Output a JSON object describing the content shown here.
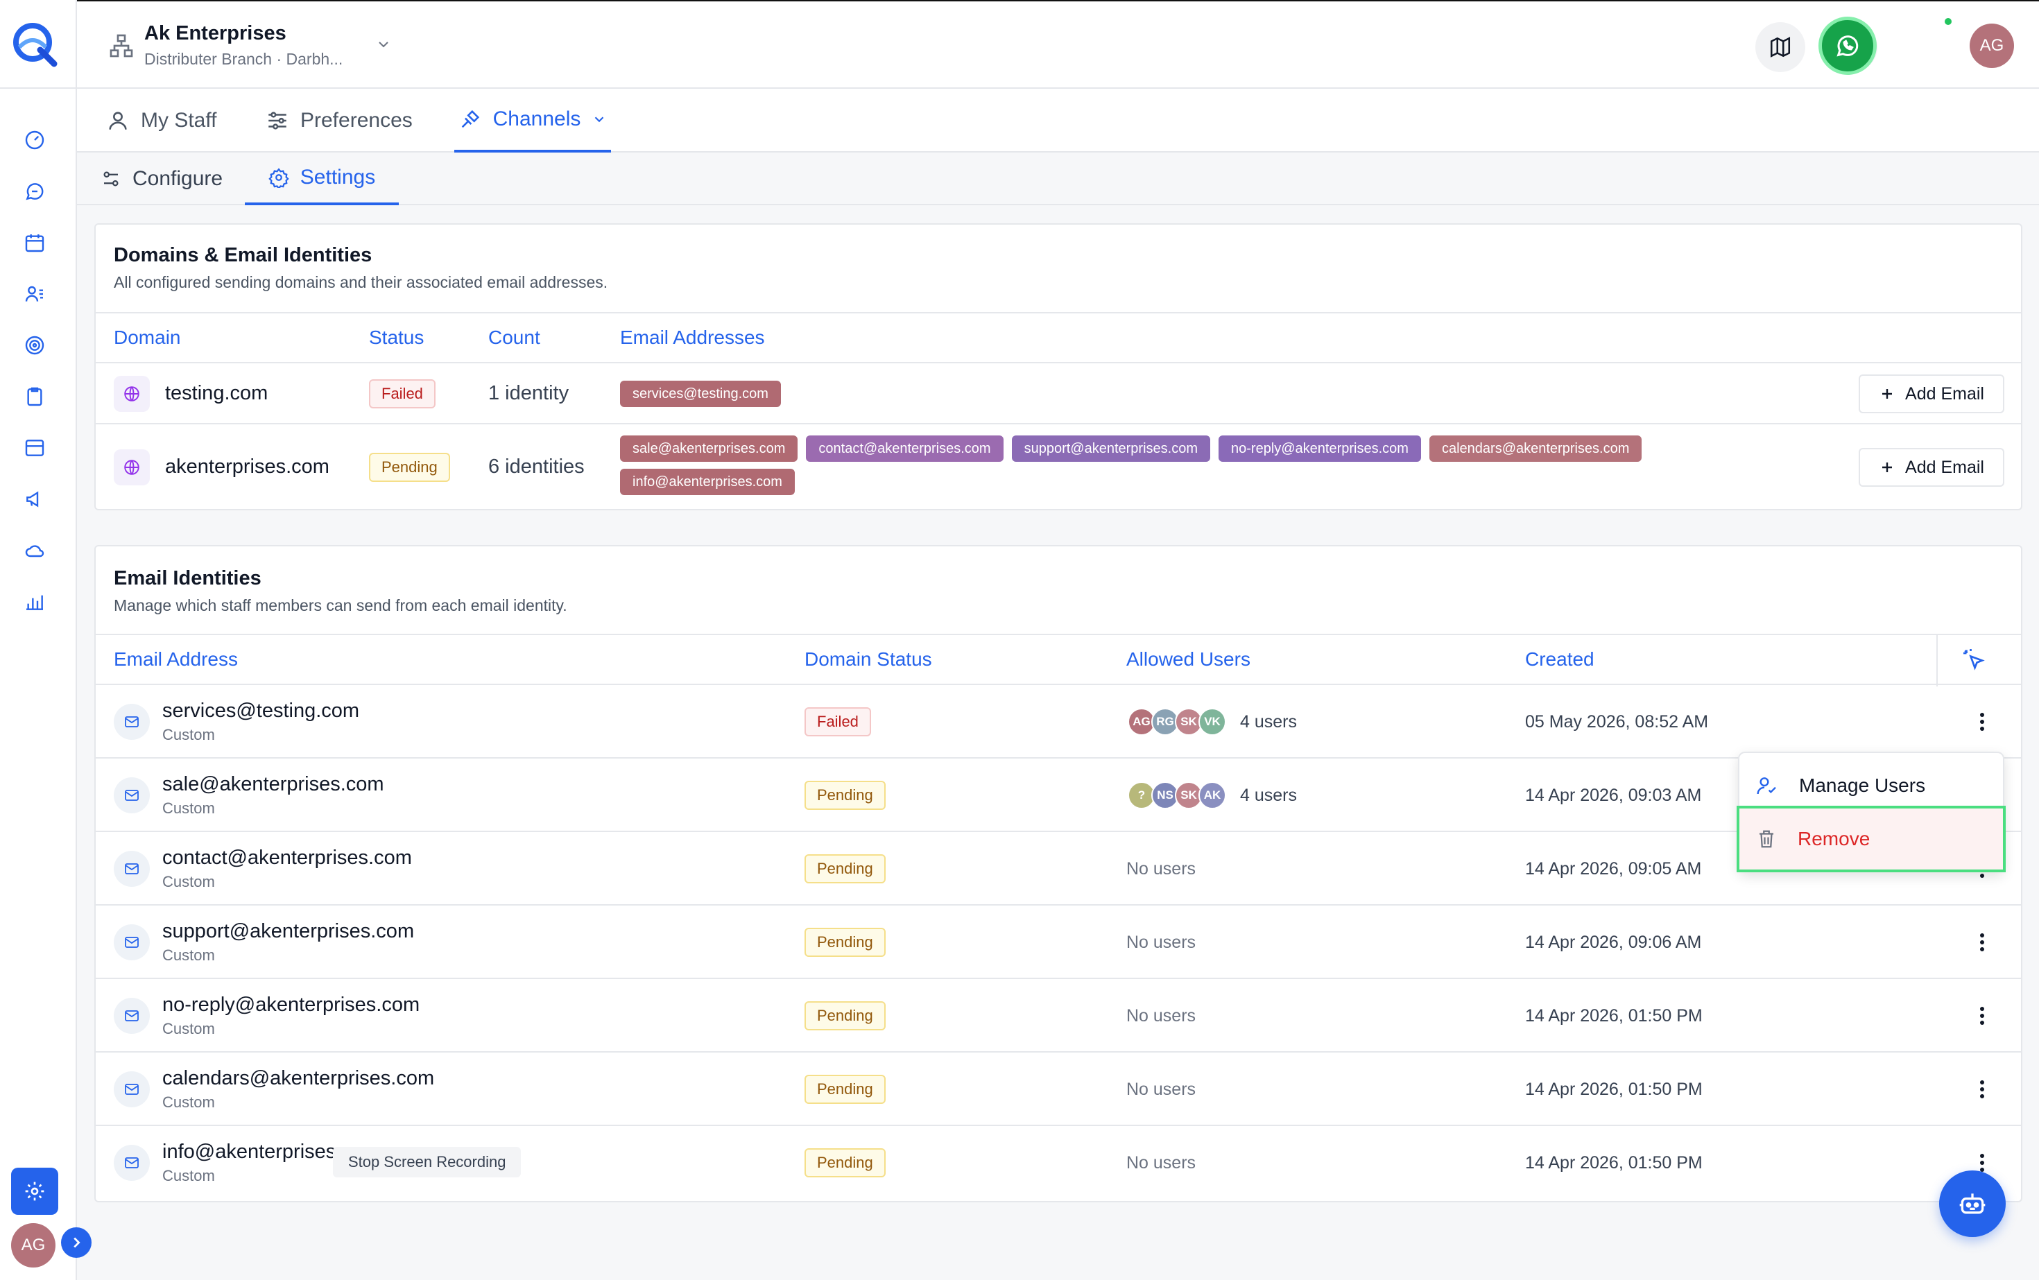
{
  "header": {
    "org_name": "Ak Enterprises",
    "org_sub": "Distributer Branch · Darbh...",
    "avatar": "AG"
  },
  "sidebar": {
    "icons": [
      "dashboard-icon",
      "chat-icon",
      "calendar-icon",
      "contacts-icon",
      "target-icon",
      "clipboard-icon",
      "inbox-icon",
      "megaphone-icon",
      "cloud-icon",
      "bar-chart-icon"
    ],
    "avatar": "AG"
  },
  "tabs": [
    {
      "label": "My Staff"
    },
    {
      "label": "Preferences"
    },
    {
      "label": "Channels"
    }
  ],
  "subtabs": [
    {
      "label": "Configure"
    },
    {
      "label": "Settings"
    }
  ],
  "domains_card": {
    "title": "Domains & Email Identities",
    "description": "All configured sending domains and their associated email addresses.",
    "columns": [
      "Domain",
      "Status",
      "Count",
      "Email Addresses"
    ],
    "add_label": "Add Email",
    "rows": [
      {
        "domain": "testing.com",
        "status": "Failed",
        "count": "1 identity",
        "emails": [
          "services@testing.com"
        ]
      },
      {
        "domain": "akenterprises.com",
        "status": "Pending",
        "count": "6 identities",
        "emails": [
          "sale@akenterprises.com",
          "contact@akenterprises.com",
          "support@akenterprises.com",
          "no-reply@akenterprises.com",
          "calendars@akenterprises.com",
          "info@akenterprises.com"
        ]
      }
    ]
  },
  "chip_colors": [
    "#b06a72",
    "#9b6bb0",
    "#8b6bb5",
    "#8a6ab8",
    "#b4727a",
    "#b06a72"
  ],
  "identities_card": {
    "title": "Email Identities",
    "description": "Manage which staff members can send from each email identity.",
    "columns": [
      "Email Address",
      "Domain Status",
      "Allowed Users",
      "Created"
    ],
    "rows": [
      {
        "email": "services@testing.com",
        "type": "Custom",
        "status": "Failed",
        "users": [
          "AG",
          "RG",
          "SK",
          "VK"
        ],
        "users_label": "4 users",
        "created": "05 May 2026, 08:52 AM"
      },
      {
        "email": "sale@akenterprises.com",
        "type": "Custom",
        "status": "Pending",
        "users": [
          "?",
          "NS",
          "SK",
          "AK"
        ],
        "users_label": "4 users",
        "created": "14 Apr 2026, 09:03 AM"
      },
      {
        "email": "contact@akenterprises.com",
        "type": "Custom",
        "status": "Pending",
        "users": [],
        "users_label": "No users",
        "created": "14 Apr 2026, 09:05 AM"
      },
      {
        "email": "support@akenterprises.com",
        "type": "Custom",
        "status": "Pending",
        "users": [],
        "users_label": "No users",
        "created": "14 Apr 2026, 09:06 AM"
      },
      {
        "email": "no-reply@akenterprises.com",
        "type": "Custom",
        "status": "Pending",
        "users": [],
        "users_label": "No users",
        "created": "14 Apr 2026, 01:50 PM"
      },
      {
        "email": "calendars@akenterprises.com",
        "type": "Custom",
        "status": "Pending",
        "users": [],
        "users_label": "No users",
        "created": "14 Apr 2026, 01:50 PM"
      },
      {
        "email": "info@akenterprises.com",
        "type": "Custom",
        "status": "Pending",
        "users": [],
        "users_label": "No users",
        "created": "14 Apr 2026, 01:50 PM"
      }
    ]
  },
  "avatar_colors": {
    "AG": "#b4727a",
    "RG": "#8aa2b4",
    "SK": "#c0848c",
    "VK": "#7fb59a",
    "?": "#b7b87a",
    "NS": "#7d86b8",
    "AK": "#8a8fc0"
  },
  "context_menu": {
    "manage_users": "Manage Users",
    "remove": "Remove"
  },
  "tooltip": "Stop Screen Recording",
  "accent": "#2563eb"
}
